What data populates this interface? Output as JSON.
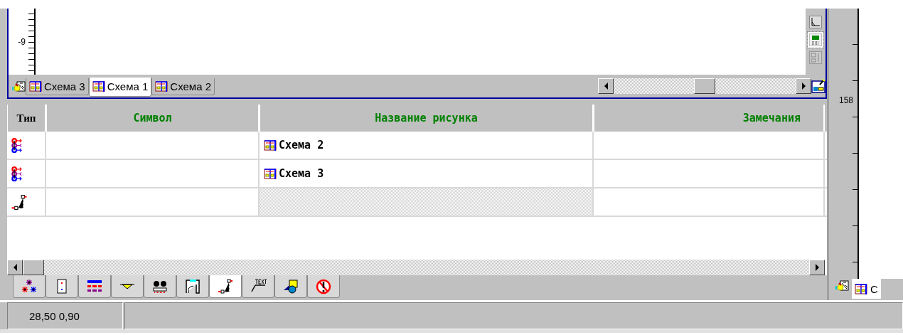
{
  "drawing_window": {
    "ruler_label": "-9",
    "tabs": [
      {
        "label": "Схема 3",
        "selected": false
      },
      {
        "label": "Схема 1",
        "selected": true
      },
      {
        "label": "Схема 2",
        "selected": false
      }
    ],
    "tools": [
      {
        "kind": "angle",
        "selected": false
      },
      {
        "kind": "grid",
        "selected": true
      },
      {
        "kind": "layout",
        "selected": false
      }
    ]
  },
  "table": {
    "columns": [
      "Тип",
      "Символ",
      "Название рисунка",
      "Замечания"
    ],
    "rows": [
      {
        "kind": "bus",
        "drawing": "Схема 2",
        "disabled": false
      },
      {
        "kind": "bus",
        "drawing": "Схема 3",
        "disabled": false
      },
      {
        "kind": "link",
        "disabled": true
      }
    ]
  },
  "palette": [
    {
      "kind": "stars",
      "selected": false
    },
    {
      "kind": "dots",
      "selected": false
    },
    {
      "kind": "bars",
      "selected": false
    },
    {
      "kind": "funnel",
      "selected": false
    },
    {
      "kind": "device",
      "selected": false
    },
    {
      "kind": "frame",
      "selected": false
    },
    {
      "kind": "link",
      "selected": true
    },
    {
      "kind": "text",
      "selected": false
    },
    {
      "kind": "shapes",
      "selected": false
    },
    {
      "kind": "forbidden",
      "selected": false
    }
  ],
  "side_panel": {
    "ruler_label": "158",
    "tabs": [
      {
        "label": "С",
        "selected": true
      }
    ]
  },
  "status_bar": {
    "coordinates": "28,50 0,90"
  }
}
